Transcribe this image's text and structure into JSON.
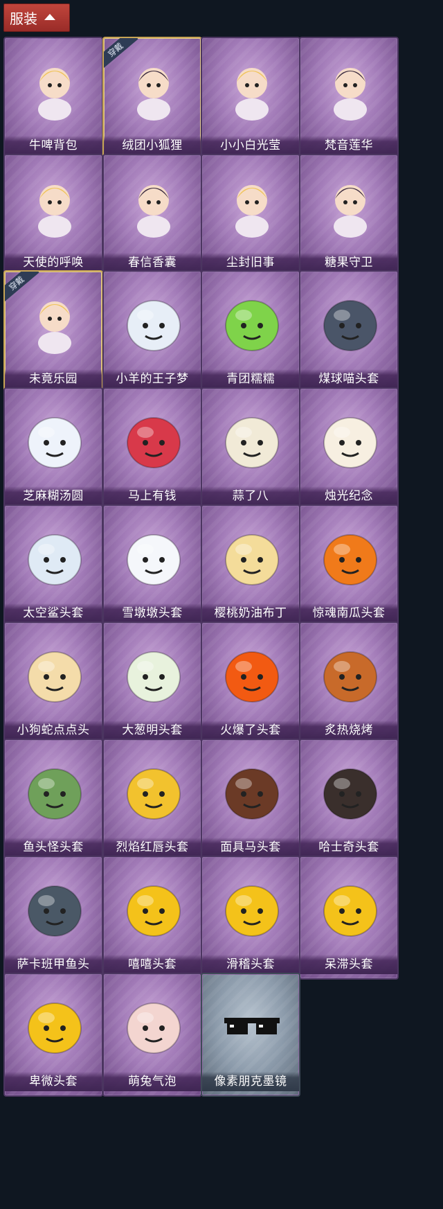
{
  "header": {
    "title": "服装"
  },
  "items": [
    {
      "label": "牛啤背包",
      "icon": "cow-backpack-icon",
      "equipped": false
    },
    {
      "label": "绒团小狐狸",
      "icon": "fox-plush-icon",
      "equipped": true,
      "badge": "穿戴"
    },
    {
      "label": "小小白光莹",
      "icon": "doll-gold-crown-icon",
      "equipped": false
    },
    {
      "label": "梵音莲华",
      "icon": "lotus-doll-icon",
      "equipped": false
    },
    {
      "label": "天使的呼唤",
      "icon": "angel-doll-icon",
      "equipped": false
    },
    {
      "label": "春信香囊",
      "icon": "sachet-icon",
      "equipped": false
    },
    {
      "label": "尘封旧事",
      "icon": "prince-doll-icon",
      "equipped": false
    },
    {
      "label": "糖果守卫",
      "icon": "pumpkin-guard-icon",
      "equipped": false
    },
    {
      "label": "未竟乐园",
      "icon": "jester-doll-icon",
      "equipped": true,
      "badge": "穿戴"
    },
    {
      "label": "小羊的王子梦",
      "icon": "sheep-crown-icon",
      "equipped": false
    },
    {
      "label": "青团糯糯",
      "icon": "green-mochi-icon",
      "equipped": false
    },
    {
      "label": "煤球喵头套",
      "icon": "black-cat-icon",
      "equipped": false
    },
    {
      "label": "芝麻糊汤圆",
      "icon": "tangyuan-icon",
      "equipped": false
    },
    {
      "label": "马上有钱",
      "icon": "red-horse-icon",
      "equipped": false
    },
    {
      "label": "蒜了八",
      "icon": "garlic-icon",
      "equipped": false
    },
    {
      "label": "烛光纪念",
      "icon": "candle-icon",
      "equipped": false
    },
    {
      "label": "太空鲨头套",
      "icon": "space-shark-icon",
      "equipped": false
    },
    {
      "label": "雪墩墩头套",
      "icon": "snowman-icon",
      "equipped": false
    },
    {
      "label": "樱桃奶油布丁",
      "icon": "pudding-icon",
      "equipped": false
    },
    {
      "label": "惊魂南瓜头套",
      "icon": "jack-o-lantern-icon",
      "equipped": false
    },
    {
      "label": "小狗蛇点点头",
      "icon": "dog-snake-icon",
      "equipped": false
    },
    {
      "label": "大葱明头套",
      "icon": "scallion-icon",
      "equipped": false
    },
    {
      "label": "火爆了头套",
      "icon": "fire-icon",
      "equipped": false
    },
    {
      "label": "炙热烧烤",
      "icon": "bbq-icon",
      "equipped": false
    },
    {
      "label": "鱼头怪头套",
      "icon": "fish-head-icon",
      "equipped": false
    },
    {
      "label": "烈焰红唇头套",
      "icon": "pikachu-lips-icon",
      "equipped": false
    },
    {
      "label": "面具马头套",
      "icon": "horse-mask-icon",
      "equipped": false
    },
    {
      "label": "哈士奇头套",
      "icon": "husky-icon",
      "equipped": false
    },
    {
      "label": "萨卡班甲鱼头",
      "icon": "sacabambaspis-icon",
      "equipped": false
    },
    {
      "label": "嘻嘻头套",
      "icon": "grin-emoji-icon",
      "equipped": false
    },
    {
      "label": "滑稽头套",
      "icon": "funny-emoji-icon",
      "equipped": false
    },
    {
      "label": "呆滞头套",
      "icon": "dazed-emoji-icon",
      "equipped": false
    },
    {
      "label": "卑微头套",
      "icon": "humble-emoji-icon",
      "equipped": false
    },
    {
      "label": "萌兔气泡",
      "icon": "bunny-bubble-icon",
      "equipped": false
    },
    {
      "label": "像素朋克墨镜",
      "icon": "pixel-sunglasses-icon",
      "equipped": false,
      "pixel": true
    }
  ],
  "colors": {
    "header_red": "#b03b34",
    "card_purple": "#a27bb8",
    "card_pixel_gray": "#8c9bab",
    "equipped_gold": "#c8a555",
    "background": "#0f1721"
  }
}
